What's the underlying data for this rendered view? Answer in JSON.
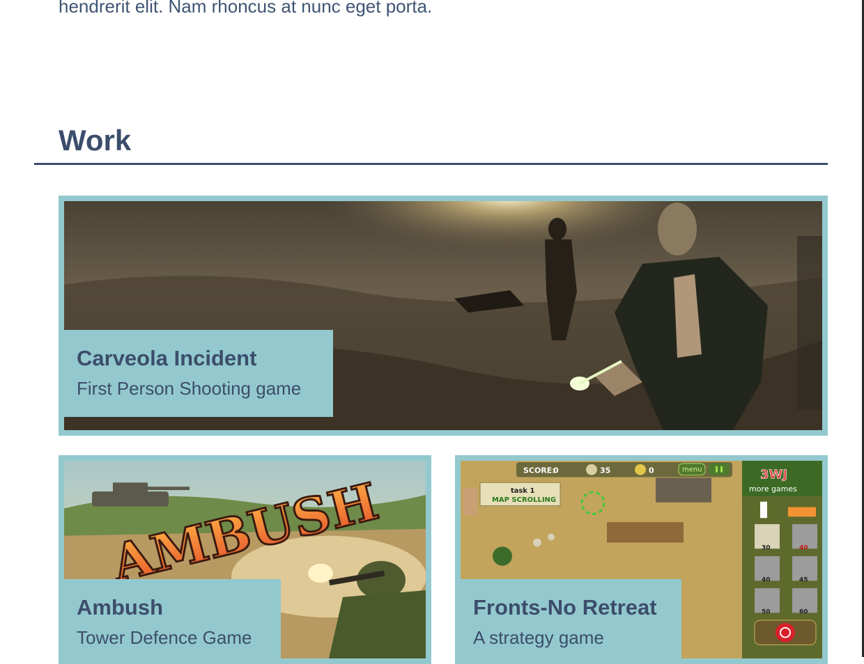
{
  "intro": {
    "text": "hendrerit elit. Nam rhoncus at nunc eget porta."
  },
  "work": {
    "title": "Work",
    "projects": [
      {
        "title": "Carveola Incident",
        "subtitle": "First Person Shooting game"
      },
      {
        "title": "Ambush",
        "subtitle": "Tower Defence Game",
        "art_text": "AMBUSH"
      },
      {
        "title": "Fronts-No Retreat",
        "subtitle": "A strategy game",
        "hud": {
          "score_label": "SCORE:",
          "score_value": "0",
          "coins": "35",
          "stars": "0",
          "menu_label": "menu",
          "task_title": "task 1",
          "task_name": "MAP SCROLLING",
          "brand": "3WJ",
          "more_games": "more games",
          "unit_costs": [
            "30",
            "40",
            "40",
            "45",
            "50",
            "60"
          ]
        }
      }
    ]
  },
  "colors": {
    "accent": "#93c9ce",
    "heading": "#3c4d6b",
    "text": "#3f5472"
  }
}
